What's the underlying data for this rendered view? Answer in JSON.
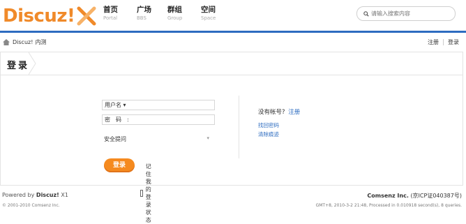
{
  "header": {
    "logo_text": "Discuz!",
    "nav": [
      {
        "label": "首页",
        "sub": "Portal"
      },
      {
        "label": "广场",
        "sub": "BBS"
      },
      {
        "label": "群组",
        "sub": "Group"
      },
      {
        "label": "空间",
        "sub": "Space"
      }
    ],
    "search_placeholder": "请输入搜索内容"
  },
  "breadcrumb": {
    "home": "Discuz!",
    "current": "内测"
  },
  "toplinks": {
    "register": "注册",
    "login": "登录"
  },
  "panel": {
    "title": "登录"
  },
  "form": {
    "username_label": "用户名 ▾",
    "password_label": "密　码　:",
    "security_label": "安全提问",
    "security_caret": "▾",
    "login_button": "登录",
    "remember_label": "记住我的登录状态"
  },
  "side": {
    "no_account": "没有帐号?",
    "register": "注册",
    "links": [
      "找回密码",
      "清除痕迹"
    ]
  },
  "footer": {
    "powered_prefix": "Powered by",
    "powered_brand": "Discuz!",
    "powered_version": "X1",
    "copyright": "© 2001-2010 Comsenz Inc.",
    "company": "Comsenz Inc.",
    "icp": "(京ICP证040387号)",
    "meta": "GMT+8, 2010-3-2 21:48, Processed in 0.010918 second(s), 8 queries."
  },
  "colors": {
    "accent": "#f08a2a",
    "brand_blue": "#2d6cc0",
    "button": "#f58a1f"
  }
}
